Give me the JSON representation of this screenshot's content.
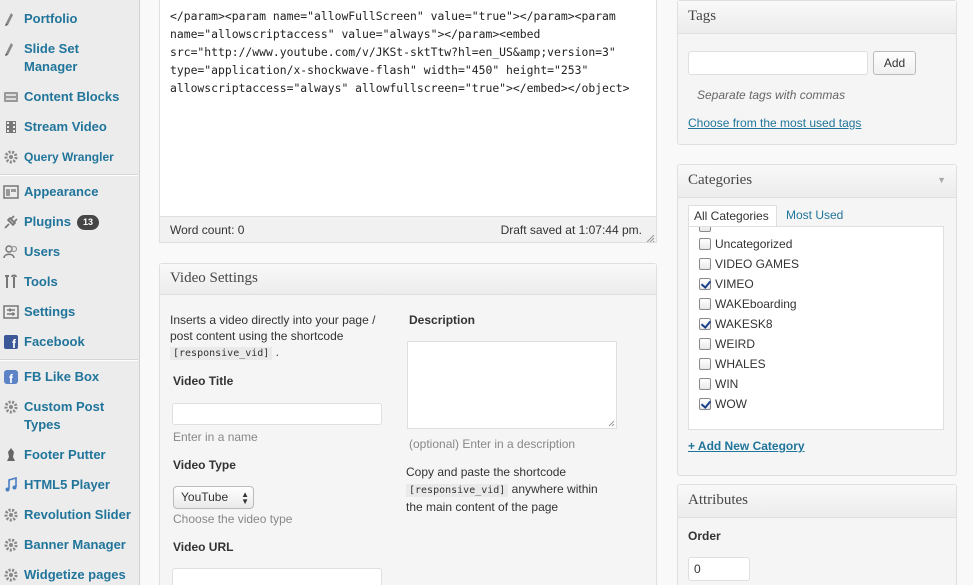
{
  "menu": {
    "items": [
      {
        "label": "Portfolio",
        "icon": "portfolio-icon"
      },
      {
        "label": "Slide Set",
        "label2": "Manager",
        "icon": "slideset-icon"
      },
      {
        "label": "Content Blocks",
        "icon": "content-blocks-icon"
      },
      {
        "label": "Stream Video",
        "icon": "film-icon"
      },
      {
        "label": "Query Wrangler",
        "icon": "gear-icon"
      },
      {
        "label": "Appearance",
        "icon": "appearance-icon"
      },
      {
        "label": "Plugins",
        "icon": "plug-icon",
        "badge": "13"
      },
      {
        "label": "Users",
        "icon": "users-icon"
      },
      {
        "label": "Tools",
        "icon": "tools-icon"
      },
      {
        "label": "Settings",
        "icon": "settings-icon"
      },
      {
        "label": "Facebook",
        "icon": "facebook-icon"
      },
      {
        "label": "FB Like Box",
        "icon": "fb-likebox-icon"
      },
      {
        "label": "Custom Post",
        "label2": "Types",
        "icon": "gear-icon"
      },
      {
        "label": "Footer Putter",
        "icon": "footer-icon"
      },
      {
        "label": "HTML5 Player",
        "icon": "music-note-icon"
      },
      {
        "label": "Revolution Slider",
        "icon": "gear-icon"
      },
      {
        "label": "Banner Manager",
        "icon": "gear-icon"
      },
      {
        "label": "Widgetize pages",
        "icon": "gear-icon"
      }
    ]
  },
  "editor": {
    "lines": [
      "</param><param name=\"allowFullScreen\" value=\"true\"></param><param",
      "name=\"allowscriptaccess\" value=\"always\"></param><embed",
      "src=\"http://www.youtube.com/v/JKSt-sktTtw?hl=en_US&amp;version=3\"",
      "type=\"application/x-shockwave-flash\" width=\"450\" height=\"253\"",
      "allowscriptaccess=\"always\" allowfullscreen=\"true\"></embed></object>"
    ],
    "word_count": "Word count: 0",
    "draft_saved": "Draft saved at 1:07:44 pm."
  },
  "video_settings": {
    "title": "Video Settings",
    "intro_line1": "Inserts a video directly into your page /",
    "intro_line2": "post content using the shortcode",
    "shortcode": "[responsive_vid]",
    "intro_end": ".",
    "video_title_label": "Video Title",
    "video_title_hint": "Enter in a name",
    "video_type_label": "Video Type",
    "video_type_value": "YouTube",
    "video_type_hint": "Choose the video type",
    "video_url_label": "Video URL",
    "description_label": "Description",
    "description_hint": "(optional) Enter in a description",
    "copy_line1": "Copy and paste the shortcode",
    "copy_shortcode": "[responsive_vid]",
    "copy_line2_rest": "anywhere within",
    "copy_line3": "the main content of the page"
  },
  "tags": {
    "title": "Tags",
    "add_label": "Add",
    "hint": "Separate tags with commas",
    "most_used": "Choose from the most used tags"
  },
  "categories": {
    "title": "Categories",
    "tab_all": "All Categories",
    "tab_most": "Most Used",
    "items": [
      {
        "label": "Uncategorized",
        "checked": false
      },
      {
        "label": "VIDEO GAMES",
        "checked": false
      },
      {
        "label": "VIMEO",
        "checked": true
      },
      {
        "label": "WAKEboarding",
        "checked": false
      },
      {
        "label": "WAKESK8",
        "checked": true
      },
      {
        "label": "WEIRD",
        "checked": false
      },
      {
        "label": "WHALES",
        "checked": false
      },
      {
        "label": "WIN",
        "checked": false
      },
      {
        "label": "WOW",
        "checked": true
      }
    ],
    "add_new": "+ Add New Category"
  },
  "attributes": {
    "title": "Attributes",
    "order_label": "Order",
    "order_value": "0"
  }
}
